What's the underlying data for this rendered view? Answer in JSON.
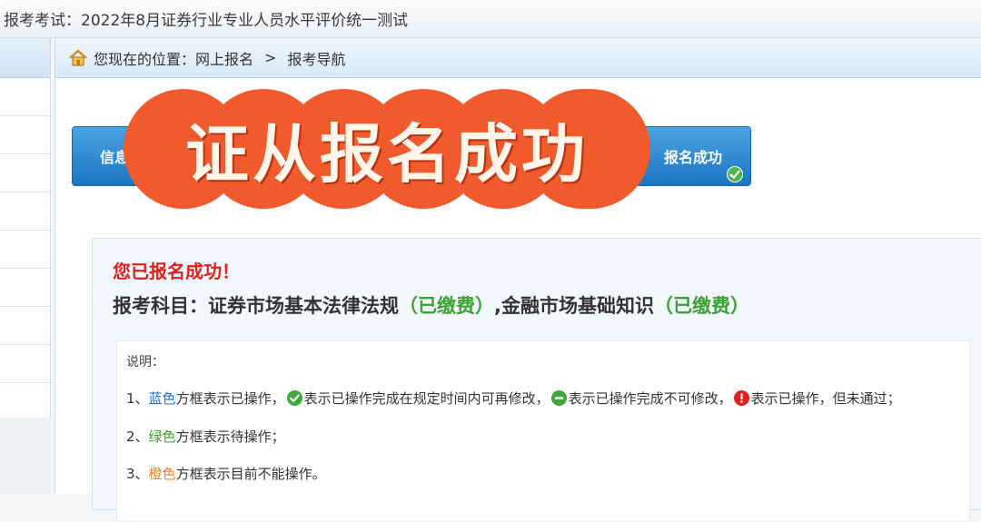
{
  "window": {
    "title": "报考考试：2022年8月证券行业专业人员水平评价统一测试"
  },
  "breadcrumb": {
    "label": "您现在的位置：",
    "item1": "网上报名",
    "separator": ">",
    "item2": "报考导航"
  },
  "steps": {
    "info_label": "信息",
    "success_label": "报名成功"
  },
  "overlay": {
    "text": "证从报名成功",
    "color": "#f15a2c"
  },
  "status": {
    "title": "您已报名成功！",
    "subjects_label": "报考科目：",
    "subject1": "证券市场基本法律法规",
    "paid1": "（已缴费）",
    "joiner": ",",
    "subject2": "金融市场基础知识",
    "paid2": "（已缴费）"
  },
  "notes": {
    "header": "说明：",
    "line1": {
      "prefix": "1、",
      "color_word": "蓝色",
      "rest": "方框表示已操作，",
      "ok_text": "表示已操作完成在规定时间内可再修改，",
      "lock_text": "表示已操作完成不可修改，",
      "warn_text": "表示已操作，但未通过；"
    },
    "line2": {
      "prefix": "2、",
      "color_word": "绿色",
      "rest": "方框表示待操作；"
    },
    "line3": {
      "prefix": "3、",
      "color_word": "橙色",
      "rest": "方框表示目前不能操作。"
    }
  },
  "icons": [
    "home-icon",
    "check-circle-icon",
    "lock-circle-icon",
    "warning-circle-icon"
  ],
  "colors": {
    "blue": "#1e6fd0",
    "green": "#3aa22f",
    "orange": "#e8812a",
    "success_red": "#e0201f",
    "step_blue": "#1b76c2"
  }
}
